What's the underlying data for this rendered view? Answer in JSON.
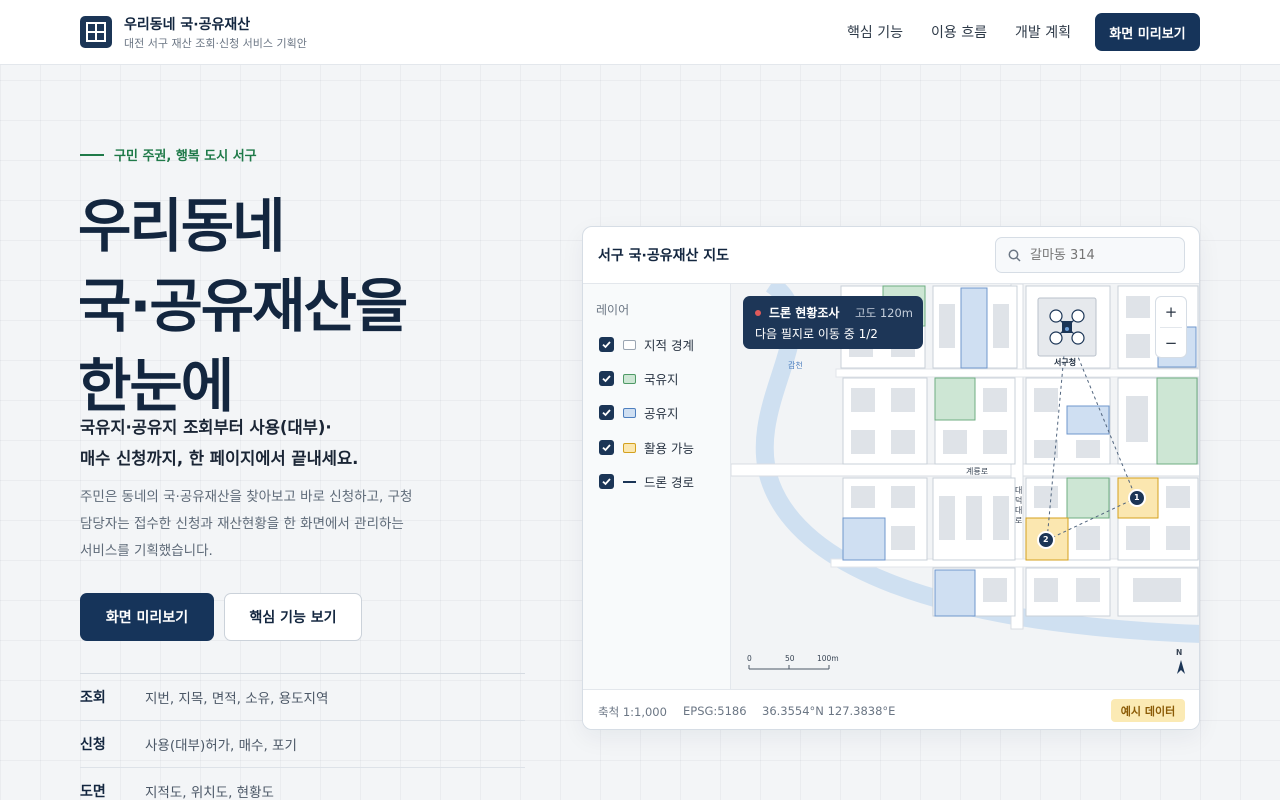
{
  "header": {
    "brand_title": "우리동네 국·공유재산",
    "brand_subtitle": "대전 서구 재산 조회·신청 서비스 기획안",
    "nav": [
      "핵심 기능",
      "이용 흐름",
      "개발 계획"
    ],
    "cta_label": "화면 미리보기"
  },
  "hero": {
    "eyebrow": "구민 주권, 행복 도시 서구",
    "title_lines": [
      "우리동네",
      "국·공유재산을",
      "한눈에"
    ],
    "lead_lines": [
      "국유지·공유지 조회부터 사용(대부)·",
      "매수 신청까지, 한 페이지에서 끝내세요."
    ],
    "desc_lines": [
      "주민은 동네의 국·공유재산을 찾아보고 바로 신청하고, 구청",
      "담당자는 접수한 신청과 재산현황을 한 화면에서 관리하는",
      "서비스를 기획했습니다."
    ],
    "primary_button": "화면 미리보기",
    "secondary_button": "핵심 기능 보기",
    "features": [
      {
        "key": "조회",
        "value": "지번, 지목, 면적, 소유, 용도지역"
      },
      {
        "key": "신청",
        "value": "사용(대부)허가, 매수, 포기"
      },
      {
        "key": "도면",
        "value": "지적도, 위치도, 현황도"
      }
    ]
  },
  "map_card": {
    "title": "서구 국·공유재산 지도",
    "search_placeholder": "갈마동 314",
    "layer_heading": "레이어",
    "layers": [
      {
        "label": "지적 경계",
        "checked": true,
        "color": "#ffffff"
      },
      {
        "label": "국유지",
        "checked": true,
        "color": "#cde6d4"
      },
      {
        "label": "공유지",
        "checked": true,
        "color": "#cfdff2"
      },
      {
        "label": "활용 가능",
        "checked": true,
        "color": "#fbe7b0"
      },
      {
        "label": "드론 경로",
        "checked": true,
        "color": "#1b3556"
      }
    ],
    "drone": {
      "title": "드론 현황조사",
      "altitude": "고도 120m",
      "status": "다음 필지로 이동 중 1/2"
    },
    "zoom_in": "+",
    "zoom_out": "−",
    "map_labels": {
      "river": "갑천",
      "road": "계룡로",
      "vertical_road": "대덕대로",
      "office": "서구청",
      "marker_1": "1",
      "marker_2": "2",
      "scale_ticks": [
        "0",
        "50",
        "100m"
      ],
      "north": "N"
    },
    "footer": {
      "scale": "축척 1:1,000",
      "crs": "EPSG:5186",
      "coords": "36.3554°N 127.3838°E",
      "badge": "예시 데이터"
    }
  },
  "colors": {
    "primary": "#16345a",
    "accent_green": "#1f7a49",
    "national_land": "#cde6d4",
    "public_land": "#cfdff2",
    "available_land": "#fbe7b0"
  }
}
